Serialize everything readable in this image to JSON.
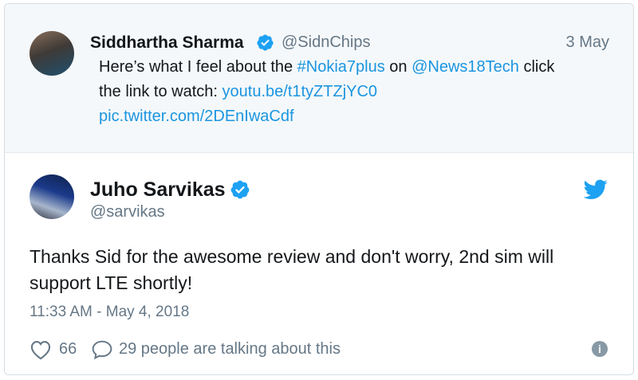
{
  "quoted_tweet": {
    "author_name": "Siddhartha Sharma",
    "author_handle": "@SidnChips",
    "date": "3 May",
    "line1_pre": "Here’s what I feel about the ",
    "hashtag": "#Nokia7plus",
    "line1_mid": " on ",
    "mention": "@News18Tech",
    "line1_post": "  click",
    "line2_pre": "the link to watch: ",
    "link1": "youtu.be/t1tyZTZjYC0",
    "link2": "pic.twitter.com/2DEnIwaCdf"
  },
  "tweet": {
    "author_name": "Juho Sarvikas",
    "author_handle": "@sarvikas",
    "text": "Thanks Sid for the awesome review and don't worry, 2nd sim will support LTE shortly!",
    "timestamp": "11:33 AM - May 4, 2018",
    "likes": "66",
    "talking": "29 people are talking about this"
  },
  "icons": {
    "verified": "verified-badge-icon",
    "bird": "twitter-bird-icon",
    "heart": "heart-icon",
    "reply": "speech-bubble-icon",
    "info": "info-icon"
  },
  "colors": {
    "link": "#1b95e0",
    "verified": "#1da1f2",
    "muted": "#657786",
    "quote_bg": "#f5f8fa"
  }
}
